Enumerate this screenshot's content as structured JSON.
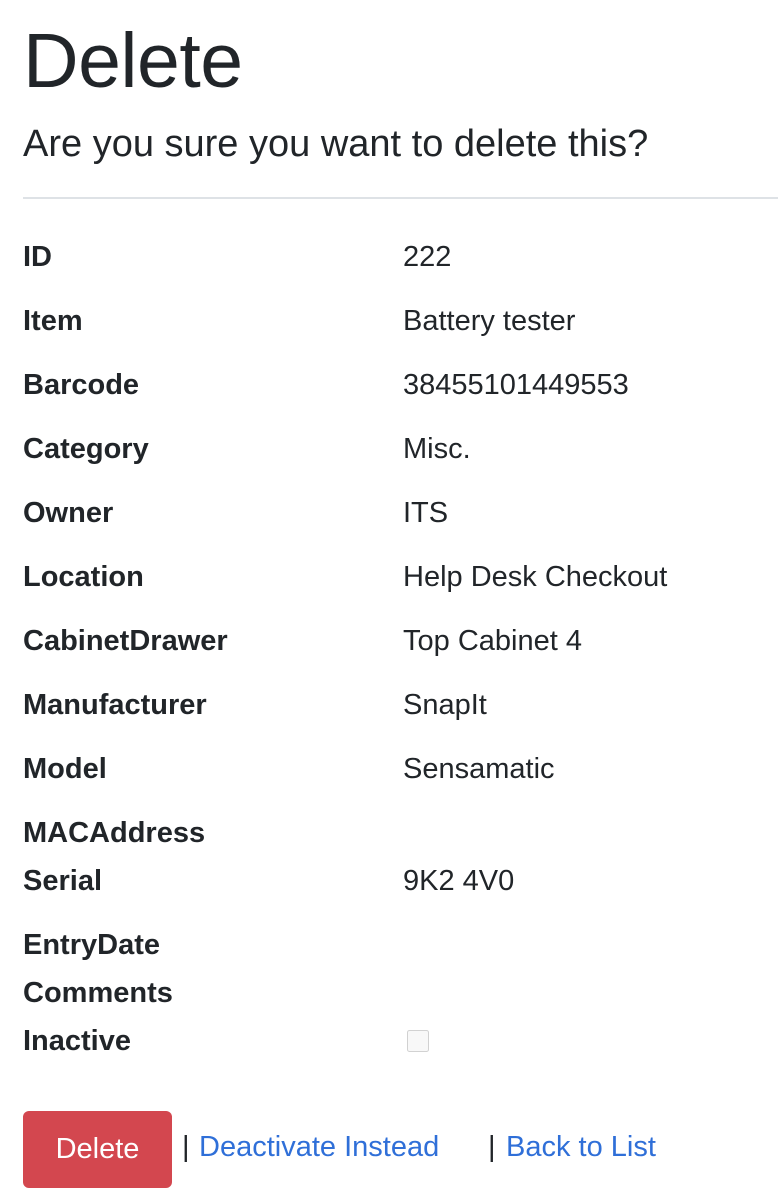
{
  "header": {
    "title": "Delete",
    "subtitle": "Are you sure you want to delete this?"
  },
  "details": [
    {
      "label": "ID",
      "value": "222"
    },
    {
      "label": "Item",
      "value": "Battery tester"
    },
    {
      "label": "Barcode",
      "value": "38455101449553"
    },
    {
      "label": "Category",
      "value": "Misc."
    },
    {
      "label": "Owner",
      "value": "ITS"
    },
    {
      "label": "Location",
      "value": "Help Desk Checkout"
    },
    {
      "label": "CabinetDrawer",
      "value": "Top Cabinet 4"
    },
    {
      "label": "Manufacturer",
      "value": "SnapIt"
    },
    {
      "label": "Model",
      "value": "Sensamatic"
    },
    {
      "label": "MACAddress",
      "value": ""
    },
    {
      "label": "Serial",
      "value": "9K2 4V0"
    },
    {
      "label": "EntryDate",
      "value": ""
    },
    {
      "label": "Comments",
      "value": ""
    },
    {
      "label": "Inactive",
      "checked": false
    }
  ],
  "actions": {
    "delete_label": "Delete",
    "separator": "|",
    "deactivate_label": "Deactivate Instead",
    "back_label": "Back to List"
  },
  "colors": {
    "danger": "#d3474f",
    "link": "#2f6fd8",
    "text": "#212529",
    "divider": "#dee2e6"
  }
}
